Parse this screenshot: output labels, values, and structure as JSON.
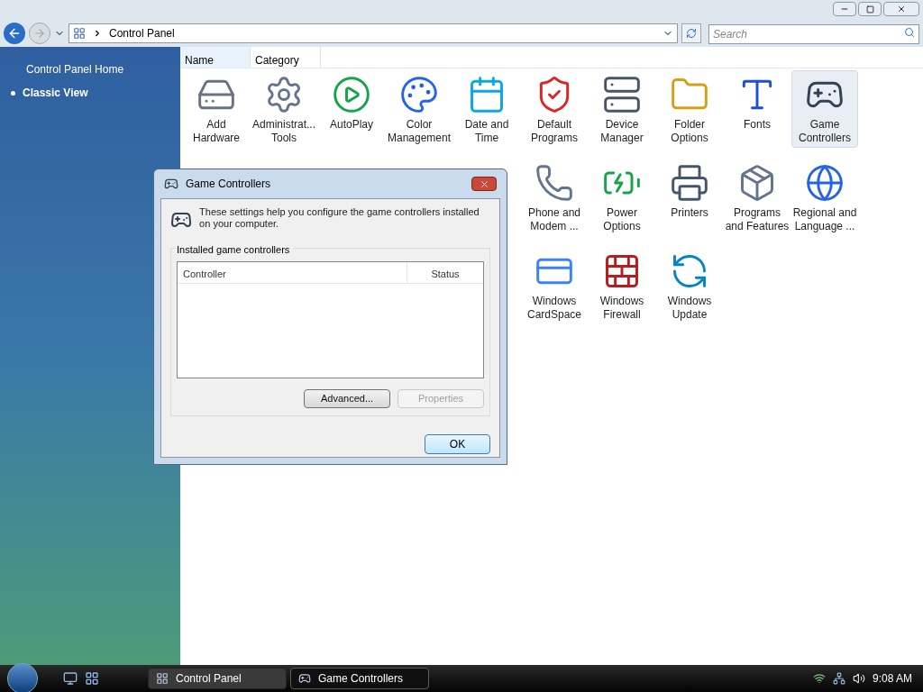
{
  "address_bar": {
    "path": "Control Panel",
    "search_placeholder": "Search"
  },
  "sidebar": {
    "items": [
      {
        "label": "Control Panel Home",
        "selected": false
      },
      {
        "label": "Classic View",
        "selected": true
      }
    ]
  },
  "columns": [
    {
      "label": "Name",
      "selected": true
    },
    {
      "label": "Category",
      "selected": false
    }
  ],
  "icon_rows": [
    [
      {
        "label": "Add Hardware",
        "selected": false
      },
      {
        "label": "Administrat... Tools",
        "selected": false
      },
      {
        "label": "AutoPlay",
        "selected": false
      },
      {
        "label": "Color Management",
        "selected": false
      },
      {
        "label": "Date and Time",
        "selected": false
      },
      {
        "label": "Default Programs",
        "selected": false
      },
      {
        "label": "Device Manager",
        "selected": false
      },
      {
        "label": "Folder Options",
        "selected": false
      },
      {
        "label": "Fonts",
        "selected": false
      },
      {
        "label": "Game Controllers",
        "selected": true
      }
    ],
    [
      {
        "label": "Phone and Modem ...",
        "selected": false
      },
      {
        "label": "Power Options",
        "selected": false
      },
      {
        "label": "Printers",
        "selected": false
      },
      {
        "label": "Programs and Features",
        "selected": false
      },
      {
        "label": "Regional and Language ...",
        "selected": false
      }
    ],
    [
      {
        "label": "Windows CardSpace",
        "selected": false
      },
      {
        "label": "Windows Firewall",
        "selected": false
      },
      {
        "label": "Windows Update",
        "selected": false
      }
    ]
  ],
  "dialog": {
    "title": "Game Controllers",
    "intro": "These settings help you configure the game controllers installed on your computer.",
    "group_label": "Installed game controllers",
    "table_columns": [
      "Controller",
      "Status"
    ],
    "buttons": [
      {
        "label": "Advanced...",
        "disabled": false
      },
      {
        "label": "Properties",
        "disabled": true
      }
    ],
    "ok": "OK"
  },
  "taskbar": {
    "tasks": [
      {
        "label": "Control Panel",
        "selected": false
      },
      {
        "label": "Game Controllers",
        "selected": true
      }
    ],
    "time": "9:08 AM"
  }
}
